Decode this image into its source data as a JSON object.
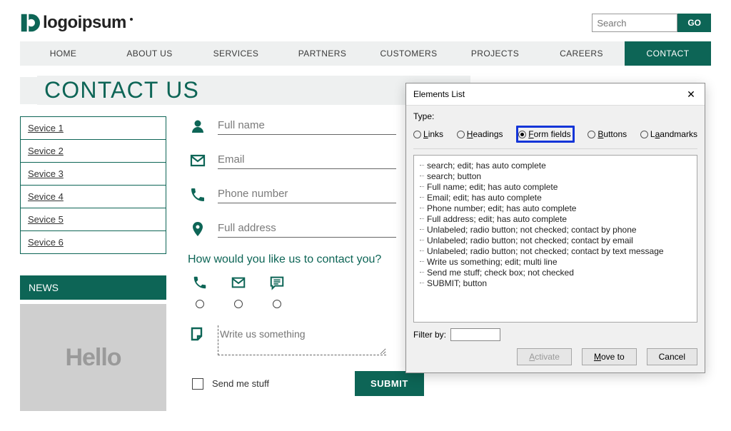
{
  "header": {
    "logo_text": "logoipsum",
    "search_placeholder": "Search",
    "search_btn": "GO"
  },
  "nav": {
    "items": [
      "HOME",
      "ABOUT US",
      "SERVICES",
      "PARTNERS",
      "CUSTOMERS",
      "PROJECTS",
      "CAREERS",
      "CONTACT"
    ],
    "active": "CONTACT"
  },
  "page_title": "CONTACT US",
  "services": [
    "Sevice 1",
    "Sevice 2",
    "Sevice 3",
    "Sevice 4",
    "Sevice 5",
    "Sevice 6"
  ],
  "news": {
    "heading": "NEWS",
    "placeholder": "Hello"
  },
  "form": {
    "full_name_ph": "Full name",
    "email_ph": "Email",
    "phone_ph": "Phone number",
    "address_ph": "Full address",
    "contact_q": "How would you like us to contact you?",
    "textarea_ph": "Write us something",
    "send_stuff": "Send me stuff",
    "submit": "SUBMIT"
  },
  "dialog": {
    "title": "Elements List",
    "type_label": "Type:",
    "types": {
      "links": "inks",
      "headings": "eadings",
      "form_fields": "orm fields",
      "buttons": "uttons",
      "landmarks": "andmarks"
    },
    "items": [
      "search; edit; has auto complete",
      "search; button",
      "Full name; edit; has auto complete",
      "Email; edit; has auto complete",
      "Phone number; edit; has auto complete",
      "Full address; edit; has auto complete",
      "Unlabeled; radio button; not checked; contact by phone",
      "Unlabeled; radio button; not checked; contact by email",
      "Unlabeled; radio button; not checked; contact by text message",
      "Write us something; edit; multi line",
      "Send me stuff; check box; not checked",
      "SUBMIT; button"
    ],
    "filter_label": "Filter by:",
    "activate": "Activate",
    "move_to": "Move to",
    "cancel": "Cancel"
  }
}
